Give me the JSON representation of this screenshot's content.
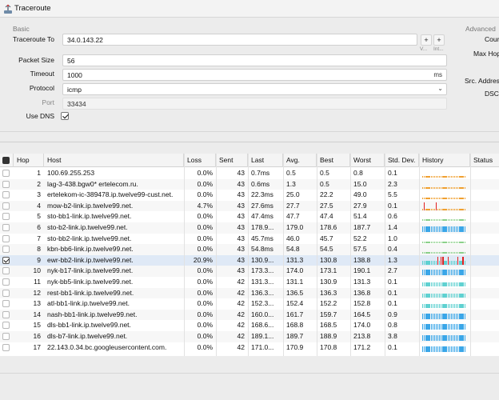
{
  "window": {
    "title": "Traceroute"
  },
  "basic": {
    "section_label": "Basic",
    "target_label": "Traceroute To",
    "target_value": "34.0.143.22",
    "v_hint": "V...",
    "int_hint": "Int...",
    "packet_size_label": "Packet Size",
    "packet_size_value": "56",
    "timeout_label": "Timeout",
    "timeout_value": "1000",
    "timeout_unit": "ms",
    "protocol_label": "Protocol",
    "protocol_value": "icmp",
    "port_label": "Port",
    "port_value": "33434",
    "use_dns_label": "Use DNS",
    "use_dns_checked": true
  },
  "advanced": {
    "section_label": "Advanced",
    "labels": [
      "Cour",
      "Max Hop",
      "Src. Addres",
      "DSCI"
    ]
  },
  "table": {
    "columns": [
      "Hop",
      "Host",
      "Loss",
      "Sent",
      "Last",
      "Avg.",
      "Best",
      "Worst",
      "Std. Dev.",
      "History",
      "Status"
    ],
    "rows": [
      {
        "hop": "1",
        "host": "100.69.255.253",
        "loss": "0.0%",
        "sent": "43",
        "last": "0.7ms",
        "avg": "0.5",
        "best": "0.5",
        "worst": "0.8",
        "stdev": "0.1",
        "history": "orange"
      },
      {
        "hop": "2",
        "host": "lag-3-438.bgw0*        ertelecom.ru.",
        "loss": "0.0%",
        "sent": "43",
        "last": "0.6ms",
        "avg": "1.3",
        "best": "0.5",
        "worst": "15.0",
        "stdev": "2.3",
        "history": "orange"
      },
      {
        "hop": "3",
        "host": "ertelekom-ic-389478.ip.twelve99-cust.net.",
        "loss": "0.0%",
        "sent": "43",
        "last": "22.3ms",
        "avg": "25.0",
        "best": "22.2",
        "worst": "49.0",
        "stdev": "5.5",
        "history": "orange"
      },
      {
        "hop": "4",
        "host": "mow-b2-link.ip.twelve99.net.",
        "loss": "4.7%",
        "sent": "43",
        "last": "27.6ms",
        "avg": "27.7",
        "best": "27.5",
        "worst": "27.9",
        "stdev": "0.1",
        "history": "orange-red"
      },
      {
        "hop": "5",
        "host": "sto-bb1-link.ip.twelve99.net.",
        "loss": "0.0%",
        "sent": "43",
        "last": "47.4ms",
        "avg": "47.7",
        "best": "47.4",
        "worst": "51.4",
        "stdev": "0.6",
        "history": "green"
      },
      {
        "hop": "6",
        "host": "sto-b2-link.ip.twelve99.net.",
        "loss": "0.0%",
        "sent": "43",
        "last": "178.9...",
        "avg": "179.0",
        "best": "178.6",
        "worst": "187.7",
        "stdev": "1.4",
        "history": "blue"
      },
      {
        "hop": "7",
        "host": "sto-bb2-link.ip.twelve99.net.",
        "loss": "0.0%",
        "sent": "43",
        "last": "45.7ms",
        "avg": "46.0",
        "best": "45.7",
        "worst": "52.2",
        "stdev": "1.0",
        "history": "green"
      },
      {
        "hop": "8",
        "host": "kbn-bb6-link.ip.twelve99.net.",
        "loss": "0.0%",
        "sent": "43",
        "last": "54.8ms",
        "avg": "54.8",
        "best": "54.5",
        "worst": "57.5",
        "stdev": "0.4",
        "history": "green"
      },
      {
        "hop": "9",
        "host": "ewr-bb2-link.ip.twelve99.net.",
        "loss": "20.9%",
        "sent": "43",
        "last": "130.9...",
        "avg": "131.3",
        "best": "130.8",
        "worst": "138.8",
        "stdev": "1.3",
        "history": "teal-red",
        "selected": true
      },
      {
        "hop": "10",
        "host": "nyk-b17-link.ip.twelve99.net.",
        "loss": "0.0%",
        "sent": "43",
        "last": "173.3...",
        "avg": "174.0",
        "best": "173.1",
        "worst": "190.1",
        "stdev": "2.7",
        "history": "blue"
      },
      {
        "hop": "11",
        "host": "nyk-bb5-link.ip.twelve99.net.",
        "loss": "0.0%",
        "sent": "42",
        "last": "131.3...",
        "avg": "131.1",
        "best": "130.9",
        "worst": "131.3",
        "stdev": "0.1",
        "history": "teal"
      },
      {
        "hop": "12",
        "host": "rest-bb1-link.ip.twelve99.net.",
        "loss": "0.0%",
        "sent": "42",
        "last": "136.3...",
        "avg": "136.5",
        "best": "136.3",
        "worst": "136.8",
        "stdev": "0.1",
        "history": "teal"
      },
      {
        "hop": "13",
        "host": "atl-bb1-link.ip.twelve99.net.",
        "loss": "0.0%",
        "sent": "42",
        "last": "152.3...",
        "avg": "152.4",
        "best": "152.2",
        "worst": "152.8",
        "stdev": "0.1",
        "history": "teal"
      },
      {
        "hop": "14",
        "host": "nash-bb1-link.ip.twelve99.net.",
        "loss": "0.0%",
        "sent": "42",
        "last": "160.0...",
        "avg": "161.7",
        "best": "159.7",
        "worst": "164.5",
        "stdev": "0.9",
        "history": "blue"
      },
      {
        "hop": "15",
        "host": "dls-bb1-link.ip.twelve99.net.",
        "loss": "0.0%",
        "sent": "42",
        "last": "168.6...",
        "avg": "168.8",
        "best": "168.5",
        "worst": "174.0",
        "stdev": "0.8",
        "history": "blue"
      },
      {
        "hop": "16",
        "host": "dls-b7-link.ip.twelve99.net.",
        "loss": "0.0%",
        "sent": "42",
        "last": "189.1...",
        "avg": "189.7",
        "best": "188.9",
        "worst": "213.8",
        "stdev": "3.8",
        "history": "blue"
      },
      {
        "hop": "17",
        "host": "22.143.0.34.bc.googleusercontent.com.",
        "loss": "0.0%",
        "sent": "42",
        "last": "171.0...",
        "avg": "170.9",
        "best": "170.8",
        "worst": "171.2",
        "stdev": "0.1",
        "history": "blue"
      }
    ]
  },
  "colors": {
    "accent": "#2f6fd6",
    "history_orange": "#f0a030",
    "history_red": "#e02020",
    "history_green": "#8bd08a",
    "history_blue": "#3aa6e8",
    "history_teal": "#5fd1d1",
    "selected_row": "#dfe9f6"
  }
}
